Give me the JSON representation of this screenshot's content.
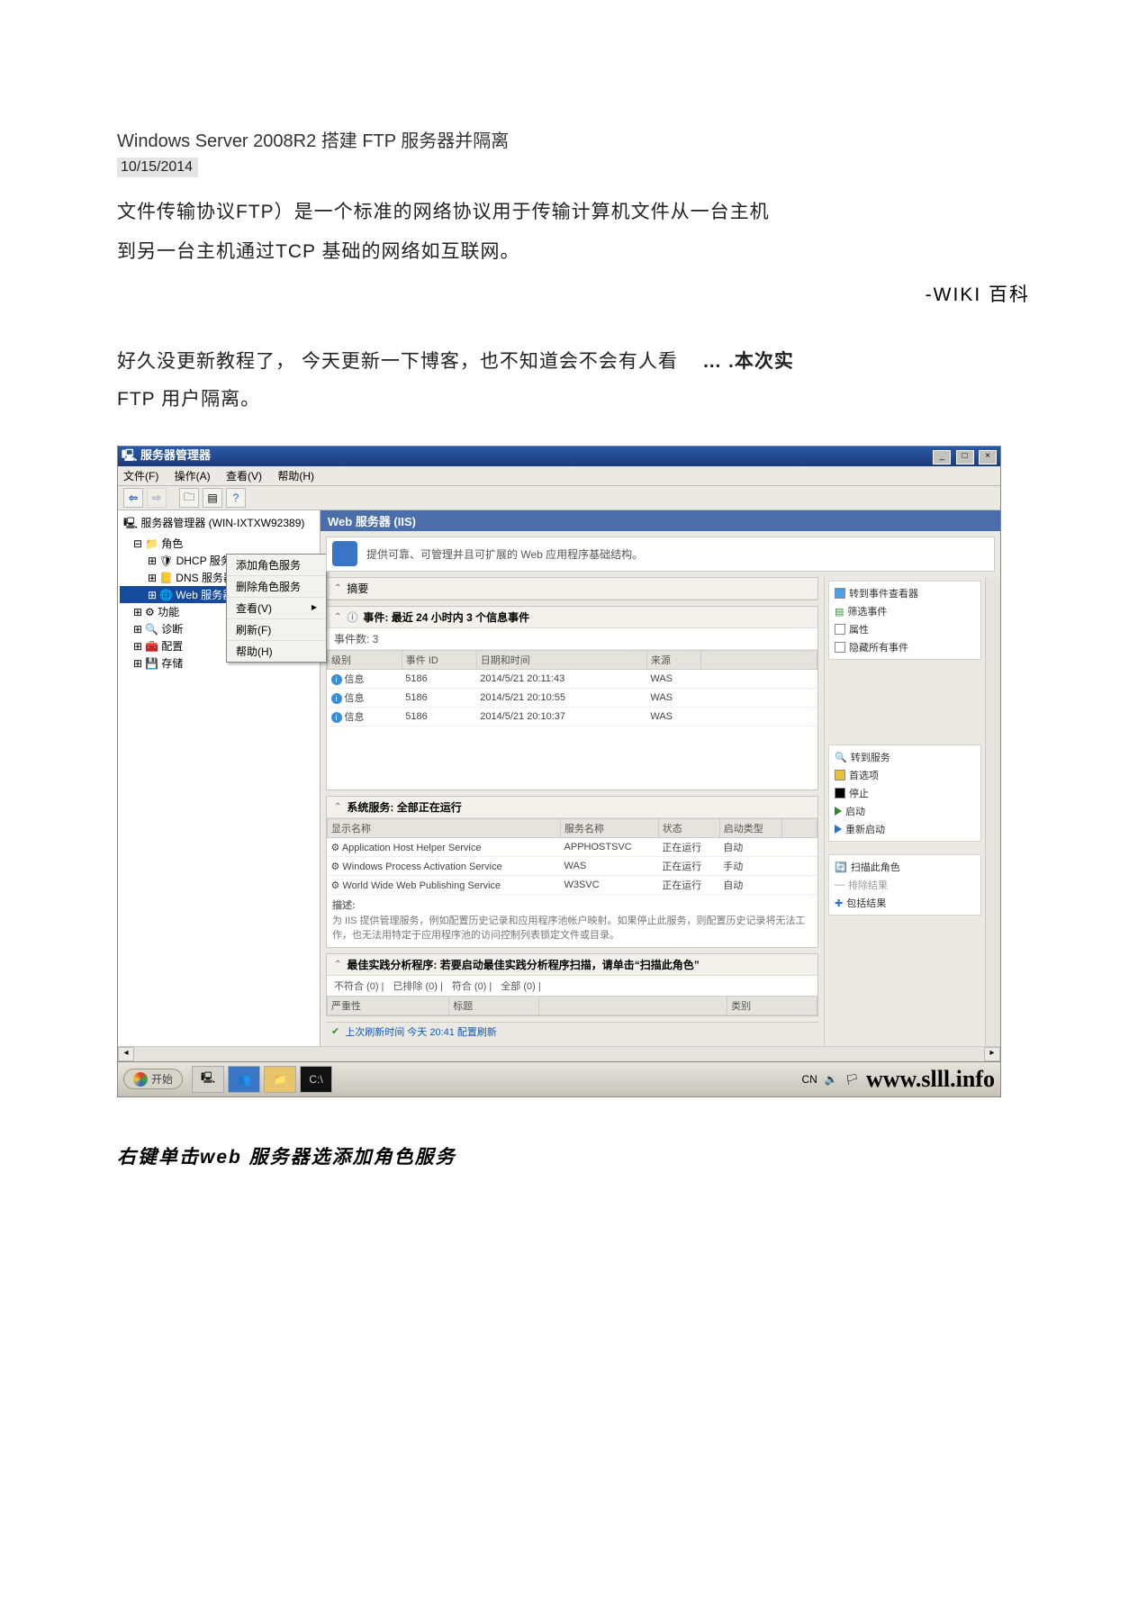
{
  "doc": {
    "title": "Windows Server 2008R2 搭建 FTP 服务器并隔离",
    "date": "10/15/2014",
    "para1": "文件传输协议FTP）是一个标准的网络协议用于传输计算机文件从一台主机",
    "para2": "到另一台主机通过TCP 基础的网络如互联网。",
    "wiki": "-WIKI 百科",
    "para3a": "好久没更新教程了，   今天更新一下博客，也不知道会不会有人看",
    "para3b": "… .本次实",
    "para4": "FTP 用户隔离。",
    "footer": "右键单击web 服务器选添加角色服务"
  },
  "win": {
    "title": "服务器管理器",
    "menus": [
      "文件(F)",
      "操作(A)",
      "查看(V)",
      "帮助(H)"
    ]
  },
  "tree": {
    "root": "服务器管理器 (WIN-IXTXW92389)",
    "n_roles": "角色",
    "n_dhcp": "DHCP 服务器",
    "n_dns": "DNS 服务器",
    "n_web": "Web 服务器",
    "n_feat": "功能",
    "n_diag": "诊断",
    "n_conf": "配置",
    "n_stor": "存储"
  },
  "ctx": {
    "add": "添加角色服务",
    "del": "删除角色服务",
    "view": "查看(V)",
    "refresh": "刷新(F)",
    "help": "帮助(H)"
  },
  "main": {
    "header": "Web 服务器 (IIS)",
    "desc": "提供可靠、可管理并且可扩展的 Web 应用程序基础结构。",
    "summary_label": "摘要"
  },
  "events": {
    "head": "事件: 最近 24 小时内 3 个信息事件",
    "count_label": "事件数: 3",
    "cols": [
      "级别",
      "事件 ID",
      "日期和时间",
      "来源"
    ],
    "rows": [
      {
        "lvl": "信息",
        "id": "5186",
        "dt": "2014/5/21 20:11:43",
        "src": "WAS"
      },
      {
        "lvl": "信息",
        "id": "5186",
        "dt": "2014/5/21 20:10:55",
        "src": "WAS"
      },
      {
        "lvl": "信息",
        "id": "5186",
        "dt": "2014/5/21 20:10:37",
        "src": "WAS"
      }
    ]
  },
  "svcs": {
    "head": "系统服务: 全部正在运行",
    "cols": [
      "显示名称",
      "服务名称",
      "状态",
      "启动类型"
    ],
    "rows": [
      {
        "dn": "Application Host Helper Service",
        "sn": "APPHOSTSVC",
        "st": "正在运行",
        "su": "自动"
      },
      {
        "dn": "Windows Process Activation Service",
        "sn": "WAS",
        "st": "正在运行",
        "su": "手动"
      },
      {
        "dn": "World Wide Web Publishing Service",
        "sn": "W3SVC",
        "st": "正在运行",
        "su": "自动"
      }
    ],
    "note_label": "描述:",
    "note": "为 IIS 提供管理服务，例如配置历史记录和应用程序池帐户映射。如果停止此服务，则配置历史记录将无法工作，也无法用特定于应用程序池的访问控制列表锁定文件或目录。"
  },
  "bpa": {
    "head": "最佳实践分析程序: 若要启动最佳实践分析程序扫描，请单击“扫描此角色”",
    "c1": "不符合 (0) |",
    "c2": "已排除 (0) |",
    "c3": "符合 (0) |",
    "c4": "全部 (0) |",
    "sev": "严重性",
    "title": "标题",
    "cat": "类别"
  },
  "status": {
    "refresh": "上次刷新时间 今天 20:41 配置刷新"
  },
  "right": {
    "ev_viewer": "转到事件查看器",
    "ev_filter": "筛选事件",
    "ev_prop": "属性",
    "ev_hide": "隐藏所有事件",
    "svc_goto": "转到服务",
    "svc_pref": "首选项",
    "svc_stop": "停止",
    "svc_start": "启动",
    "svc_restart": "重新启动",
    "bpa_scan": "扫描此角色",
    "bpa_excl": "排除结果",
    "bpa_incl": "包括结果"
  },
  "taskbar": {
    "start": "开始",
    "tray": "CN",
    "url": "www.slll.info"
  }
}
